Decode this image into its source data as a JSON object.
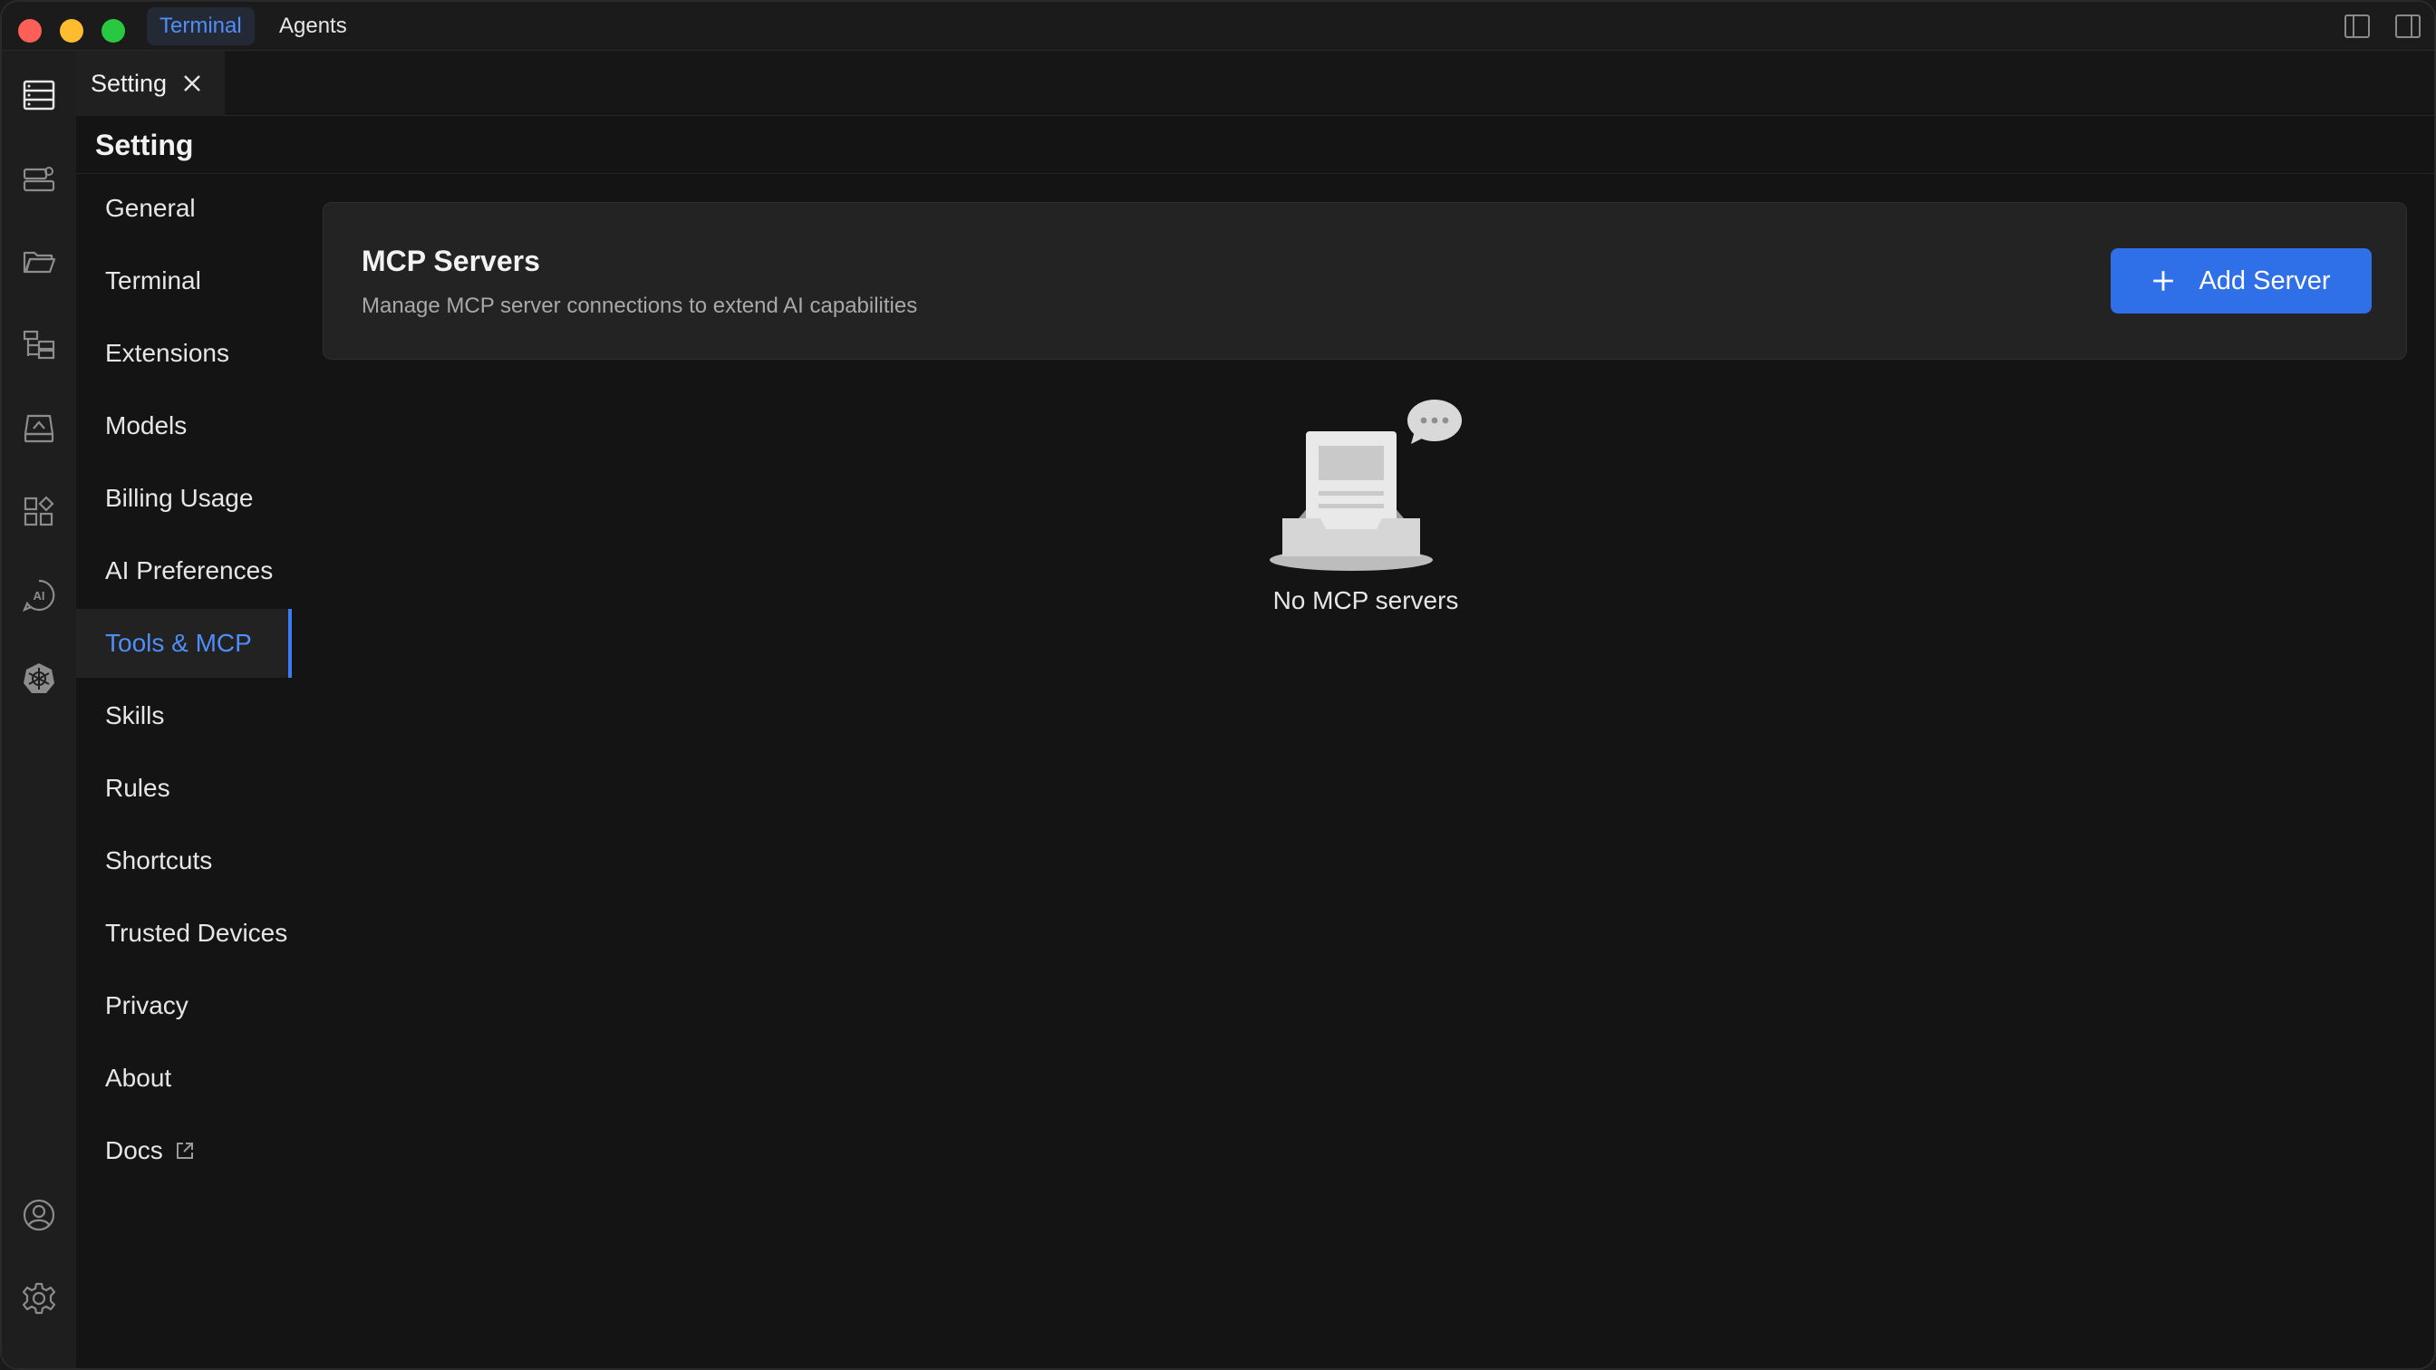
{
  "titlebar": {
    "tabs": [
      {
        "label": "Terminal",
        "active": true
      },
      {
        "label": "Agents",
        "active": false
      }
    ]
  },
  "editor_tab": {
    "label": "Setting"
  },
  "settings": {
    "title": "Setting",
    "nav": [
      {
        "label": "General"
      },
      {
        "label": "Terminal"
      },
      {
        "label": "Extensions"
      },
      {
        "label": "Models"
      },
      {
        "label": "Billing Usage"
      },
      {
        "label": "AI Preferences"
      },
      {
        "label": "Tools & MCP",
        "active": true
      },
      {
        "label": "Skills"
      },
      {
        "label": "Rules"
      },
      {
        "label": "Shortcuts"
      },
      {
        "label": "Trusted Devices"
      },
      {
        "label": "Privacy"
      },
      {
        "label": "About"
      },
      {
        "label": "Docs",
        "external": true
      }
    ]
  },
  "mcp": {
    "title": "MCP Servers",
    "description": "Manage MCP server connections to extend AI capabilities",
    "add_button": "Add Server",
    "empty_text": "No MCP servers"
  },
  "colors": {
    "accent": "#2f6fe8",
    "active_text": "#4f8ef7",
    "background": "#141414"
  },
  "icons": {
    "activity_bar": [
      "server-list-icon",
      "server-settings-icon",
      "folder-icon",
      "tree-icon",
      "storage-icon",
      "apps-icon",
      "ai-icon",
      "kubernetes-icon",
      "account-icon",
      "gear-icon"
    ]
  }
}
